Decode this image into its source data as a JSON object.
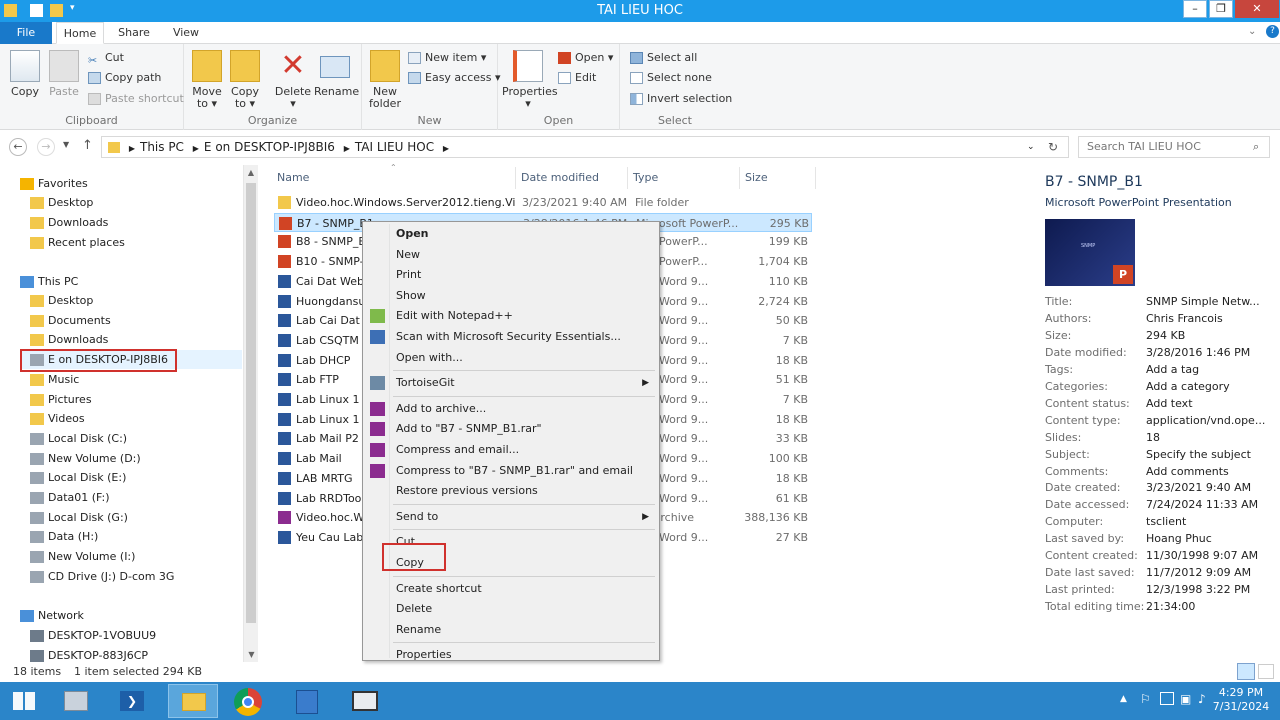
{
  "window": {
    "title": "TAI LIEU HOC"
  },
  "tabs": [
    "File",
    "Home",
    "Share",
    "View"
  ],
  "ribbon": {
    "clipboard": {
      "group": "Clipboard",
      "copy": "Copy",
      "paste": "Paste",
      "cut": "Cut",
      "copy_path": "Copy path",
      "paste_shortcut": "Paste shortcut"
    },
    "organize": {
      "group": "Organize",
      "move_to": "Move to ▾",
      "copy_to": "Copy to ▾",
      "delete": "Delete ▾",
      "rename": "Rename"
    },
    "new": {
      "group": "New",
      "new_folder": "New folder",
      "new_item": "New item ▾",
      "easy_access": "Easy access ▾"
    },
    "open": {
      "group": "Open",
      "properties": "Properties ▾",
      "open": "Open ▾",
      "edit": "Edit"
    },
    "select": {
      "group": "Select",
      "select_all": "Select all",
      "select_none": "Select none",
      "invert": "Invert selection"
    }
  },
  "address": {
    "crumbs": [
      "This PC",
      "E on DESKTOP-IPJ8BI6",
      "TAI LIEU HOC"
    ],
    "search_placeholder": "Search TAI LIEU HOC"
  },
  "nav": {
    "favorites": "Favorites",
    "fav_items": [
      "Desktop",
      "Downloads",
      "Recent places"
    ],
    "this_pc": "This PC",
    "pc_items": [
      "Desktop",
      "Documents",
      "Downloads",
      "E on DESKTOP-IPJ8BI6",
      "Music",
      "Pictures",
      "Videos",
      "Local Disk (C:)",
      "New Volume (D:)",
      "Local Disk (E:)",
      "Data01 (F:)",
      "Local Disk (G:)",
      "Data (H:)",
      "New Volume (I:)",
      "CD Drive (J:) D-com 3G"
    ],
    "network": "Network",
    "net_items": [
      "DESKTOP-1VOBUU9",
      "DESKTOP-883J6CP"
    ]
  },
  "columns": {
    "name": "Name",
    "date": "Date modified",
    "type": "Type",
    "size": "Size"
  },
  "files": [
    {
      "name": "Video.hoc.Windows.Server2012.tieng.Viet",
      "date": "3/23/2021 9:40 AM",
      "type": "File folder",
      "size": "",
      "kind": "folder"
    },
    {
      "name": "B7 - SNMP_B1",
      "date": "3/28/2016 1:46 PM",
      "type": "Microsoft PowerP...",
      "size": "295 KB",
      "kind": "ppt"
    },
    {
      "name": "B8 - SNMP_B",
      "date": "",
      "type": "soft PowerP...",
      "size": "199 KB",
      "kind": "ppt"
    },
    {
      "name": "B10 - SNMP-",
      "date": "",
      "type": "soft PowerP...",
      "size": "1,704 KB",
      "kind": "ppt"
    },
    {
      "name": "Cai Dat Web",
      "date": "",
      "type": "soft Word 9...",
      "size": "110 KB",
      "kind": "doc"
    },
    {
      "name": "Huongdansu",
      "date": "",
      "type": "soft Word 9...",
      "size": "2,724 KB",
      "kind": "doc"
    },
    {
      "name": "Lab Cai Dat D",
      "date": "",
      "type": "soft Word 9...",
      "size": "50 KB",
      "kind": "doc"
    },
    {
      "name": "Lab CSQTM -",
      "date": "",
      "type": "soft Word 9...",
      "size": "7 KB",
      "kind": "doc"
    },
    {
      "name": "Lab DHCP",
      "date": "",
      "type": "soft Word 9...",
      "size": "18 KB",
      "kind": "doc"
    },
    {
      "name": "Lab FTP",
      "date": "",
      "type": "soft Word 9...",
      "size": "51 KB",
      "kind": "doc"
    },
    {
      "name": "Lab Linux 1 B",
      "date": "",
      "type": "soft Word 9...",
      "size": "7 KB",
      "kind": "doc"
    },
    {
      "name": "Lab Linux 1 T",
      "date": "",
      "type": "soft Word 9...",
      "size": "18 KB",
      "kind": "doc"
    },
    {
      "name": "Lab Mail P2",
      "date": "",
      "type": "soft Word 9...",
      "size": "33 KB",
      "kind": "doc"
    },
    {
      "name": "Lab Mail",
      "date": "",
      "type": "soft Word 9...",
      "size": "100 KB",
      "kind": "doc"
    },
    {
      "name": "LAB MRTG",
      "date": "",
      "type": "soft Word 9...",
      "size": "18 KB",
      "kind": "doc"
    },
    {
      "name": "Lab RRDTool",
      "date": "",
      "type": "soft Word 9...",
      "size": "61 KB",
      "kind": "doc"
    },
    {
      "name": "Video.hoc.Wi",
      "date": "",
      "type": "AR archive",
      "size": "388,136 KB",
      "kind": "rar"
    },
    {
      "name": "Yeu Cau Lab",
      "date": "",
      "type": "soft Word 9...",
      "size": "27 KB",
      "kind": "doc"
    }
  ],
  "context_menu": [
    {
      "label": "Open",
      "bold": true
    },
    {
      "label": "New"
    },
    {
      "label": "Print"
    },
    {
      "label": "Show"
    },
    {
      "label": "Edit with Notepad++",
      "icon": "notepad"
    },
    {
      "label": "Scan with Microsoft Security Essentials...",
      "icon": "shield"
    },
    {
      "label": "Open with..."
    },
    {
      "sep": true
    },
    {
      "label": "TortoiseGit",
      "icon": "tortoise",
      "sub": true
    },
    {
      "sep": true
    },
    {
      "label": "Add to archive...",
      "icon": "rar"
    },
    {
      "label": "Add to \"B7 - SNMP_B1.rar\"",
      "icon": "rar"
    },
    {
      "label": "Compress and email...",
      "icon": "rar"
    },
    {
      "label": "Compress to \"B7 - SNMP_B1.rar\" and email",
      "icon": "rar"
    },
    {
      "label": "Restore previous versions"
    },
    {
      "sep": true
    },
    {
      "label": "Send to",
      "sub": true
    },
    {
      "sep": true
    },
    {
      "label": "Cut"
    },
    {
      "label": "Copy"
    },
    {
      "sep": true
    },
    {
      "label": "Create shortcut"
    },
    {
      "label": "Delete"
    },
    {
      "label": "Rename"
    },
    {
      "sep": true
    },
    {
      "label": "Properties"
    }
  ],
  "details": {
    "title": "B7 - SNMP_B1",
    "subtitle": "Microsoft PowerPoint Presentation",
    "thumb_text": "SNMP",
    "props": [
      [
        "Title:",
        "SNMP Simple Netw..."
      ],
      [
        "Authors:",
        "Chris Francois"
      ],
      [
        "Size:",
        "294 KB"
      ],
      [
        "Date modified:",
        "3/28/2016 1:46 PM"
      ],
      [
        "Tags:",
        "Add a tag"
      ],
      [
        "Categories:",
        "Add a category"
      ],
      [
        "Content status:",
        "Add text"
      ],
      [
        "Content type:",
        "application/vnd.ope..."
      ],
      [
        "Slides:",
        "18"
      ],
      [
        "Subject:",
        "Specify the subject"
      ],
      [
        "Comments:",
        "Add comments"
      ],
      [
        "Date created:",
        "3/23/2021 9:40 AM"
      ],
      [
        "Date accessed:",
        "7/24/2024 11:33 AM"
      ],
      [
        "Computer:",
        "tsclient"
      ],
      [
        "Last saved by:",
        "Hoang Phuc"
      ],
      [
        "Content created:",
        "11/30/1998 9:07 AM"
      ],
      [
        "Date last saved:",
        "11/7/2012 9:09 AM"
      ],
      [
        "Last printed:",
        "12/3/1998 3:22 PM"
      ],
      [
        "Total editing time:",
        "21:34:00"
      ]
    ]
  },
  "status": {
    "items": "18 items",
    "selected": "1 item selected  294 KB"
  },
  "taskbar": {
    "time": "4:29 PM",
    "date": "7/31/2024"
  },
  "colors": {
    "accent": "#1d9be9",
    "taskbar": "#2b85c9",
    "selection": "#cce8ff",
    "highlight_box": "#d0312d"
  }
}
